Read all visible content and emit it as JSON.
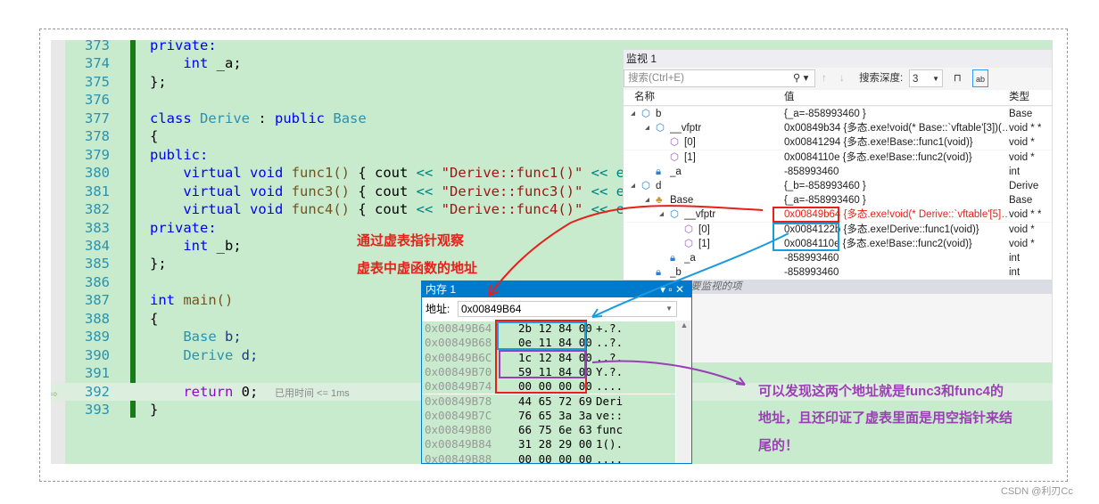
{
  "editor": {
    "lines": [
      {
        "n": "373",
        "parts": [
          [
            "kw",
            "private"
          ],
          [
            "",
            "："
          ]
        ]
      },
      {
        "n": "374"
      },
      {
        "n": "375"
      },
      {
        "n": "376"
      },
      {
        "n": "377"
      },
      {
        "n": "378"
      },
      {
        "n": "379"
      },
      {
        "n": "380"
      },
      {
        "n": "381"
      },
      {
        "n": "382"
      },
      {
        "n": "383"
      },
      {
        "n": "384"
      },
      {
        "n": "385"
      },
      {
        "n": "386"
      },
      {
        "n": "387"
      },
      {
        "n": "388"
      },
      {
        "n": "389"
      },
      {
        "n": "390"
      },
      {
        "n": "391"
      },
      {
        "n": "392"
      },
      {
        "n": "393"
      }
    ],
    "code": {
      "l373": "private:",
      "l374a": "int",
      " l374b": " _a;",
      "l375": "};",
      "l377a": "class",
      "l377b": "Derive",
      "l377c": " : ",
      "l377d": "public",
      "l377e": "Base",
      "l378": "{",
      "l379": "public:",
      "virtual": "virtual",
      "void": "void",
      "cout": " { cout ",
      "shl": "<<",
      "f1": "func1()",
      "f3": "func3()",
      "f4": "func4()",
      "s1": "\"Derive::func1()\"",
      "s3": "\"Derive::func3()\"",
      "s4": "\"Derive::func4()\"",
      "tail": " << e",
      "l383": "private:",
      "l384a": "int",
      "l384b": " _b;",
      "l385": "};",
      "l387a": "int",
      "l387b": "main()",
      "l388": "{",
      "l389a": "Base",
      "l389b": " b;",
      "l390a": "Derive",
      "l390b": " d;",
      "l392a": "return",
      "l392b": " 0;",
      "l392hint": "已用时间 <= 1ms",
      "l393": "}"
    }
  },
  "watch": {
    "title": "监视 1",
    "search_placeholder": "搜索(Ctrl+E)",
    "depth_label": "搜索深度:",
    "depth_value": "3",
    "headers": [
      "名称",
      "值",
      "类型"
    ],
    "rows": [
      {
        "indent": 0,
        "exp": "◢",
        "name": "b",
        "value": "{_a=-858993460 }",
        "type": "Base",
        "icon": "object-icon"
      },
      {
        "indent": 1,
        "exp": "◢",
        "name": "__vfptr",
        "value": "0x00849b34 {多态.exe!void(* Base::`vftable'[3])(…",
        "type": "void * *",
        "icon": "object-icon"
      },
      {
        "indent": 2,
        "exp": "",
        "name": "[0]",
        "value": "0x00841294 {多态.exe!Base::func1(void)}",
        "type": "void *",
        "icon": "cube-icon"
      },
      {
        "indent": 2,
        "exp": "",
        "name": "[1]",
        "value": "0x0084110e {多态.exe!Base::func2(void)}",
        "type": "void *",
        "icon": "cube-icon"
      },
      {
        "indent": 1,
        "exp": "",
        "name": "_a",
        "value": "-858993460",
        "type": "int",
        "icon": "field-icon"
      },
      {
        "indent": 0,
        "exp": "◢",
        "name": "d",
        "value": "{_b=-858993460 }",
        "type": "Derive",
        "icon": "object-icon"
      },
      {
        "indent": 1,
        "exp": "◢",
        "name": "Base",
        "value": "{_a=-858993460 }",
        "type": "Base",
        "icon": "base-class-icon"
      },
      {
        "indent": 2,
        "exp": "◢",
        "name": "__vfptr",
        "value": "0x00849b64 {多态.exe!void(* Derive::`vftable'[5]…",
        "type": "void * *",
        "icon": "object-icon",
        "red": true
      },
      {
        "indent": 3,
        "exp": "",
        "name": "[0]",
        "value": "0x0084122b {多态.exe!Derive::func1(void)}",
        "type": "void *",
        "icon": "cube-icon"
      },
      {
        "indent": 3,
        "exp": "",
        "name": "[1]",
        "value": "0x0084110e {多态.exe!Base::func2(void)}",
        "type": "void *",
        "icon": "cube-icon"
      },
      {
        "indent": 2,
        "exp": "",
        "name": "_a",
        "value": "-858993460",
        "type": "int",
        "icon": "field-icon"
      },
      {
        "indent": 1,
        "exp": "",
        "name": "_b",
        "value": "-858993460",
        "type": "int",
        "icon": "field-icon"
      },
      {
        "indent": 1,
        "exp": "",
        "name": "添加要监视的项",
        "value": "",
        "type": "",
        "icon": "",
        "add": true
      }
    ]
  },
  "memory": {
    "title": "内存 1",
    "address_label": "地址:",
    "address_value": "0x00849B64",
    "rows": [
      [
        "0x00849B64",
        "2b 12 84 00",
        "+.?."
      ],
      [
        "0x00849B68",
        "0e 11 84 00",
        "..?."
      ],
      [
        "0x00849B6C",
        "1c 12 84 00",
        "..?."
      ],
      [
        "0x00849B70",
        "59 11 84 00",
        "Y.?."
      ],
      [
        "0x00849B74",
        "00 00 00 00",
        "...."
      ],
      [
        "0x00849B78",
        "44 65 72 69",
        "Deri"
      ],
      [
        "0x00849B7C",
        "76 65 3a 3a",
        "ve::"
      ],
      [
        "0x00849B80",
        "66 75 6e 63",
        "func"
      ],
      [
        "0x00849B84",
        "31 28 29 00",
        "1()."
      ],
      [
        "0x00849B88",
        "00 00 00 00",
        "...."
      ]
    ]
  },
  "annotations": {
    "red": [
      "通过虚表指针观察",
      "虚表中虚函数的地址"
    ],
    "purple": [
      "可以发现这两个地址就是func3和func4的",
      "地址，且还印证了虚表里面是用空指针来结",
      "尾的！"
    ],
    "colors": {
      "red": "#e8201a",
      "blue": "#1a9be0",
      "purple": "#9b3fb5"
    }
  },
  "watermark": "CSDN @利刃Cc"
}
